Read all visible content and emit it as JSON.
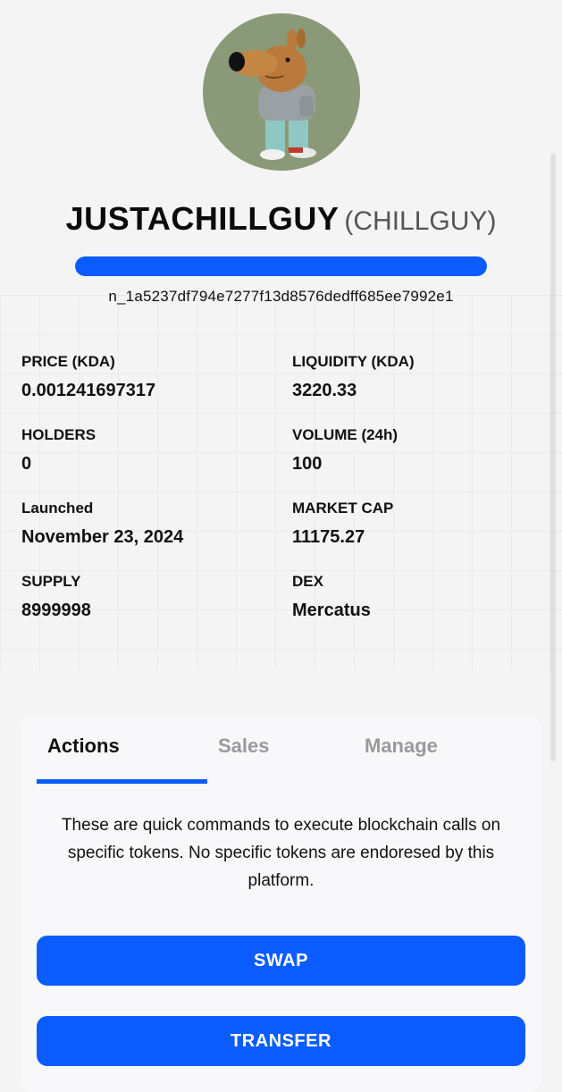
{
  "token": {
    "name": "JUSTACHILLGUY",
    "symbol": "(CHILLGUY)",
    "contract": "n_1a5237df794e7277f13d8576dedff685ee7992e1",
    "progress_fraction": 1.0,
    "accent_color": "#0a5cff"
  },
  "stats": {
    "price_label": "PRICE (KDA)",
    "price_value": "0.001241697317",
    "liquidity_label": "LIQUIDITY (KDA)",
    "liquidity_value": "3220.33",
    "holders_label": "HOLDERS",
    "holders_value": "0",
    "volume_label": "VOLUME (24h)",
    "volume_value": "100",
    "launched_label": "Launched",
    "launched_value": "November 23, 2024",
    "marketcap_label": "MARKET CAP",
    "marketcap_value": "11175.27",
    "supply_label": "SUPPLY",
    "supply_value": "8999998",
    "dex_label": "DEX",
    "dex_value": "Mercatus"
  },
  "panel": {
    "tabs": [
      {
        "label": "Actions",
        "active": true
      },
      {
        "label": "Sales",
        "active": false
      },
      {
        "label": "Manage",
        "active": false
      }
    ],
    "description": "These are quick commands to execute blockchain calls on specific tokens. No specific tokens are endoresed by this platform.",
    "swap_label": "SWAP",
    "transfer_label": "TRANSFER"
  }
}
